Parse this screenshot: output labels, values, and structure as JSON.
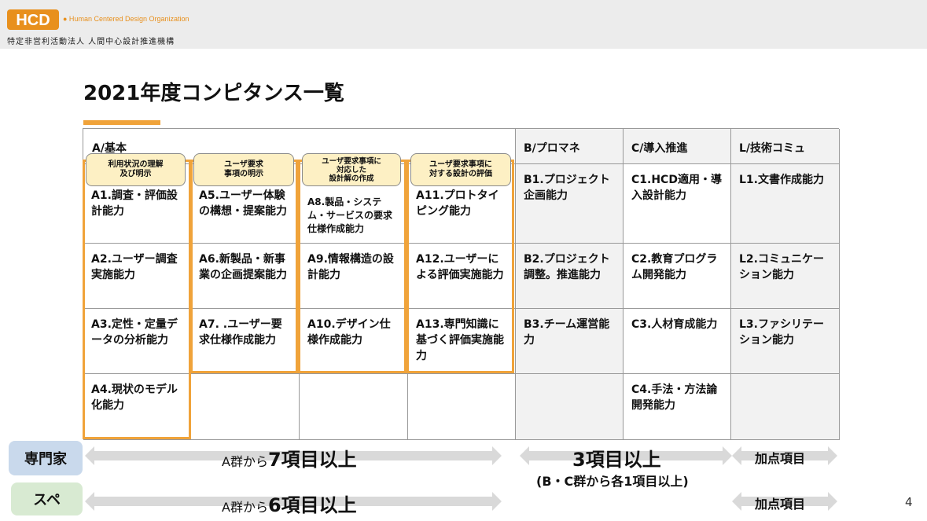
{
  "header": {
    "logo_text": "HCD",
    "tagline": "● Human Centered Design Organization",
    "org_name": "特定非営利活動法人 人間中心設計推進機構"
  },
  "title": "2021年度コンピタンス一覧",
  "table": {
    "headers": {
      "a": "A/基本",
      "b": "B/プロマネ",
      "c": "C/導入推進",
      "l": "L/技術コミュ"
    },
    "badges": [
      "利用状況の理解\n及び明示",
      "ユーザ要求\n事項の明示",
      "ユーザ要求事項に\n対応した\n設計解の作成",
      "ユーザ要求事項に\n対する設計の評価"
    ],
    "a_cols": [
      [
        "A1.調査・評価設計能力",
        "A2.ユーザー調査実施能力",
        "A3.定性・定量データの分析能力",
        "A4.現状のモデル化能力"
      ],
      [
        "A5.ユーザー体験の構想・提案能力",
        "A6.新製品・新事業の企画提案能力",
        "A7. .ユーザー要求仕様作成能力",
        ""
      ],
      [
        "A8.製品・システム・サービスの要求仕様作成能力",
        "A9.情報構造の設計能力",
        "A10.デザイン仕様作成能力",
        ""
      ],
      [
        "A11.プロトタイピング能力",
        "A12.ユーザーによる評価実施能力",
        "A13.専門知識に基づく評価実施能力",
        ""
      ]
    ],
    "b_col": [
      "B1.プロジェクト企画能力",
      "B2.プロジェクト調整。推進能力",
      "B3.チーム運営能力",
      ""
    ],
    "c_col": [
      "C1.HCD適用・導入設計能力",
      "C2.教育プログラム開発能力",
      "C3.人材育成能力",
      "C4.手法・方法論開発能力"
    ],
    "l_col": [
      "L1.文書作成能力",
      "L2.コミュニケーション能力",
      "L3.ファシリテーション能力",
      ""
    ]
  },
  "requirements": {
    "expert": {
      "label": "専門家",
      "a_prefix": "A群から",
      "a_big": "7項目以上",
      "bc_big": "3項目以上",
      "bc_note": "(B・C群から各1項目以上)",
      "l_text": "加点項目"
    },
    "specialist": {
      "label": "スペ",
      "a_prefix": "A群から",
      "a_big": "6項目以上",
      "l_text": "加点項目"
    }
  },
  "page_number": "4",
  "colors": {
    "accent_orange": "#f0a33a",
    "badge_fill": "#fdf0c4",
    "expert_fill": "#c9d9ec",
    "specialist_fill": "#d8ead2",
    "arrow_gray": "#d9d9d9"
  }
}
